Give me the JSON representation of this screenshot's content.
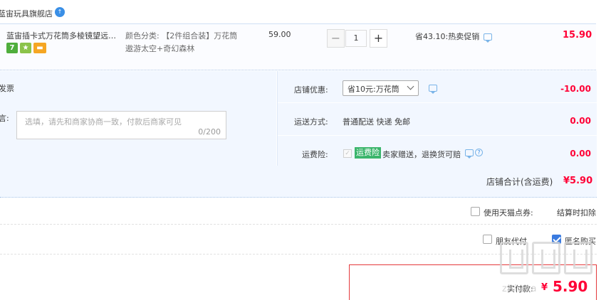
{
  "store": {
    "name": "蓝宙玩具旗舰店",
    "badge": "↑"
  },
  "item": {
    "title": "蓝宙插卡式万花筒多棱镜望远镜...",
    "tags": [
      {
        "label": "7",
        "color": "#4fae3c"
      },
      {
        "label": "★",
        "color": "#8bc34a"
      },
      {
        "label": "▬",
        "color": "#f5a623"
      }
    ],
    "sku_line1": "颜色分类: 【2件组合装】万花筒",
    "sku_line2": "遨游太空+奇幻森林",
    "unit_price": "59.00",
    "qty_minus": "−",
    "quantity": "1",
    "qty_plus": "+",
    "promo": "省43.10:热卖促销",
    "subtotal": "15.90"
  },
  "invoice": {
    "label": "发票"
  },
  "message": {
    "label": "言:",
    "placeholder": "选填，请先和商家协商一致，付款后商家可见",
    "counter": "0/200"
  },
  "shop_coupon": {
    "label": "店铺优惠:",
    "selected": "省10元:万花筒",
    "amount": "-10.00"
  },
  "shipping": {
    "label": "运送方式:",
    "method": "普通配送 快递 免邮",
    "amount": "0.00"
  },
  "freight_insurance": {
    "label": "运费险:",
    "badge": "运费险",
    "text": "卖家赠送，退换货可赔",
    "help": "?",
    "amount": "0.00"
  },
  "store_total": {
    "label": "店铺合计(含运费)",
    "value": "¥5.90"
  },
  "tmall_points": {
    "label": "使用天猫点券:",
    "note": "结算时扣除"
  },
  "options": {
    "friend_pay": "朋友代付",
    "anonymous": "匿名购买"
  },
  "payment": {
    "label": "实付款:",
    "currency": "¥",
    "value": "5.90"
  },
  "watermark": {
    "text": "zhi.ma"
  },
  "colors": {
    "accent": "#ff0036",
    "panel": "#f2f7ff",
    "checkbox_checked": "#3a7be0"
  }
}
